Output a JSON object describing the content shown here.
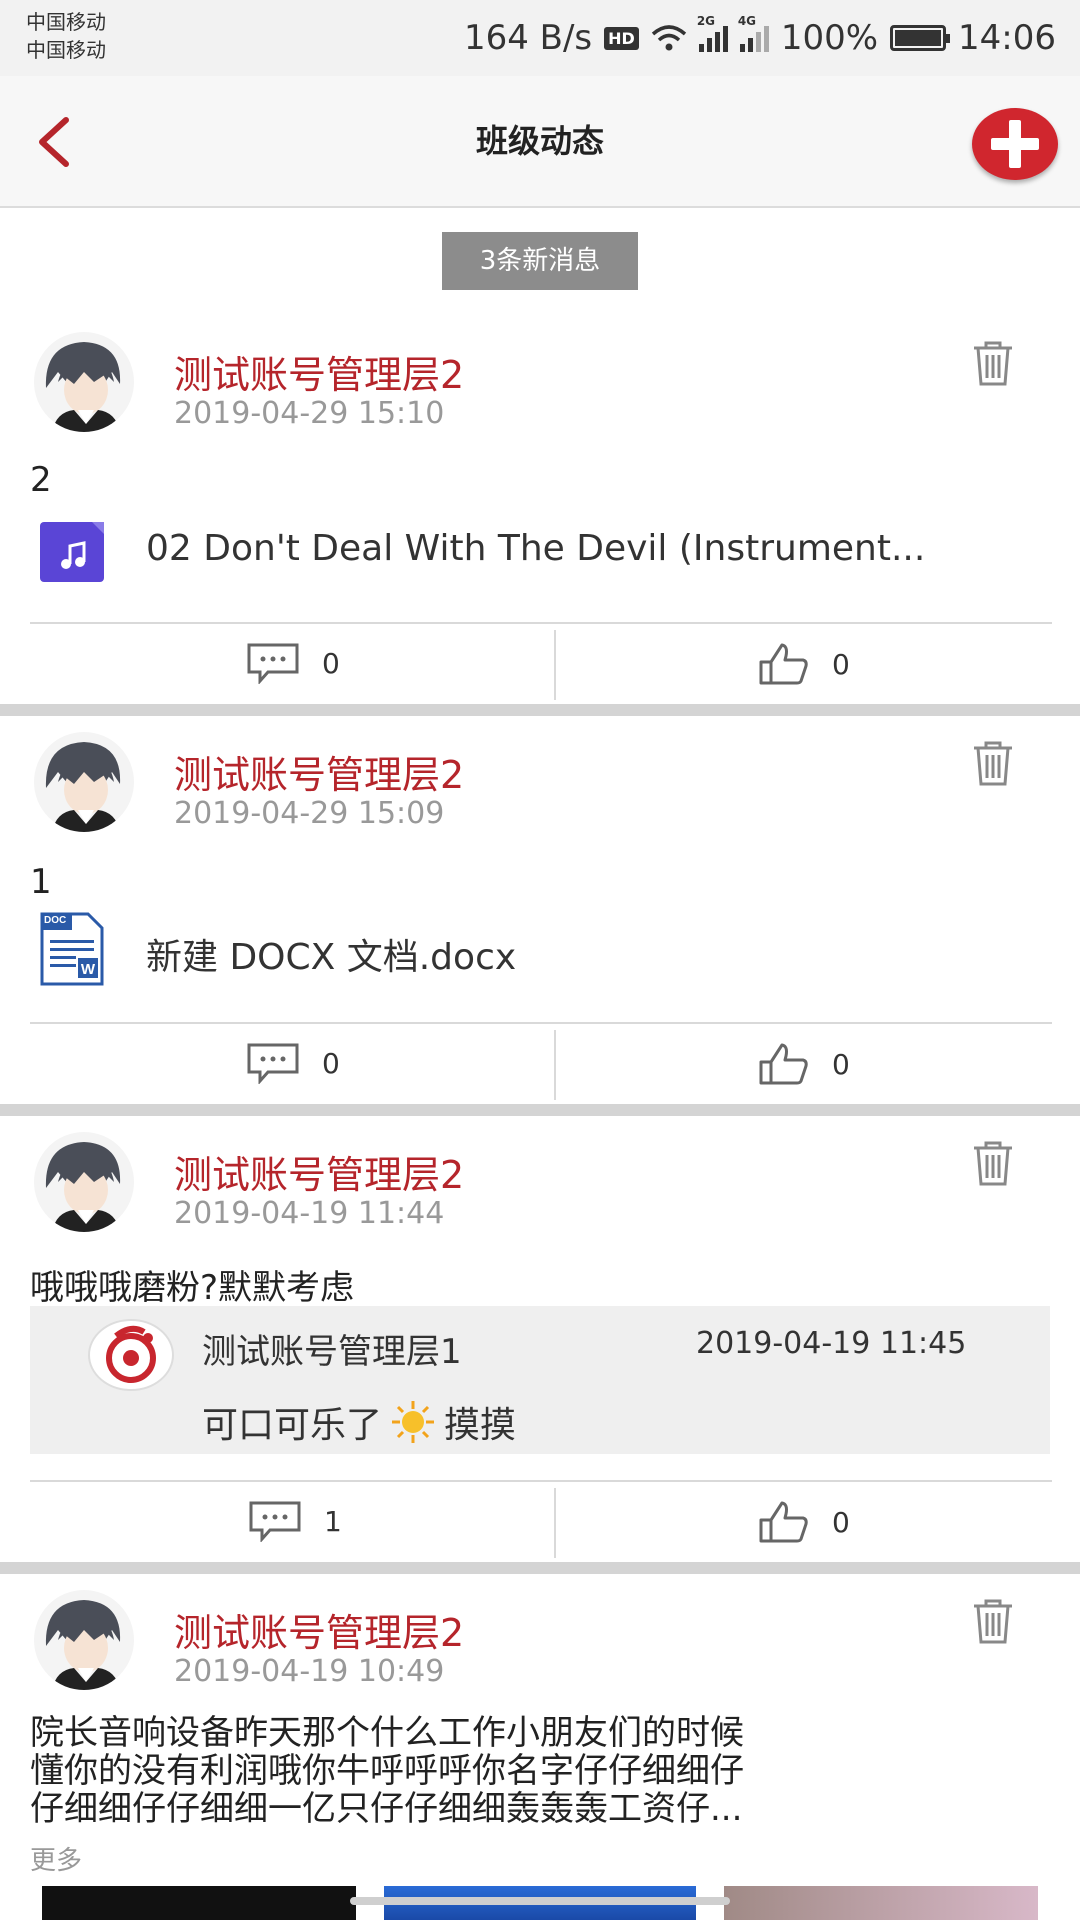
{
  "status_bar": {
    "carrier1": "中国移动",
    "carrier2": "中国移动",
    "speed": "164 B/s",
    "hd": "HD",
    "net1": "2G",
    "net2": "4G",
    "battery": "100%",
    "time": "14:06"
  },
  "header": {
    "title": "班级动态",
    "back_icon": "chevron-left-icon",
    "add_icon": "plus-circle-icon"
  },
  "new_messages": "3条新消息",
  "colors": {
    "accent": "#b5252b",
    "add_button": "#d0262e"
  },
  "posts": [
    {
      "user": "测试账号管理层2",
      "time": "2019-04-29 15:10",
      "text": "2",
      "attachment": {
        "type": "audio",
        "name": "02 Don't Deal With The Devil (Instrument..."
      },
      "comments": "0",
      "likes": "0"
    },
    {
      "user": "测试账号管理层2",
      "time": "2019-04-29 15:09",
      "text": "1",
      "attachment": {
        "type": "doc",
        "name": "新建 DOCX 文档.docx",
        "icon_label": "DOC"
      },
      "comments": "0",
      "likes": "0"
    },
    {
      "user": "测试账号管理层2",
      "time": "2019-04-19 11:44",
      "text": "哦哦哦磨粉?默默考虑",
      "reply": {
        "user": "测试账号管理层1",
        "time": "2019-04-19 11:45",
        "text": "可口可乐了",
        "emoji": "sun",
        "text_after": "摸摸"
      },
      "comments": "1",
      "likes": "0"
    },
    {
      "user": "测试账号管理层2",
      "time": "2019-04-19 10:49",
      "text_lines": [
        "院长音响设备昨天那个什么工作小朋友们的时候",
        "懂你的没有利润哦你牛呼呼呼你名字仔仔细细仔",
        "仔细细仔仔细细一亿只仔仔细细轰轰轰工资仔..."
      ],
      "more": "更多"
    }
  ]
}
